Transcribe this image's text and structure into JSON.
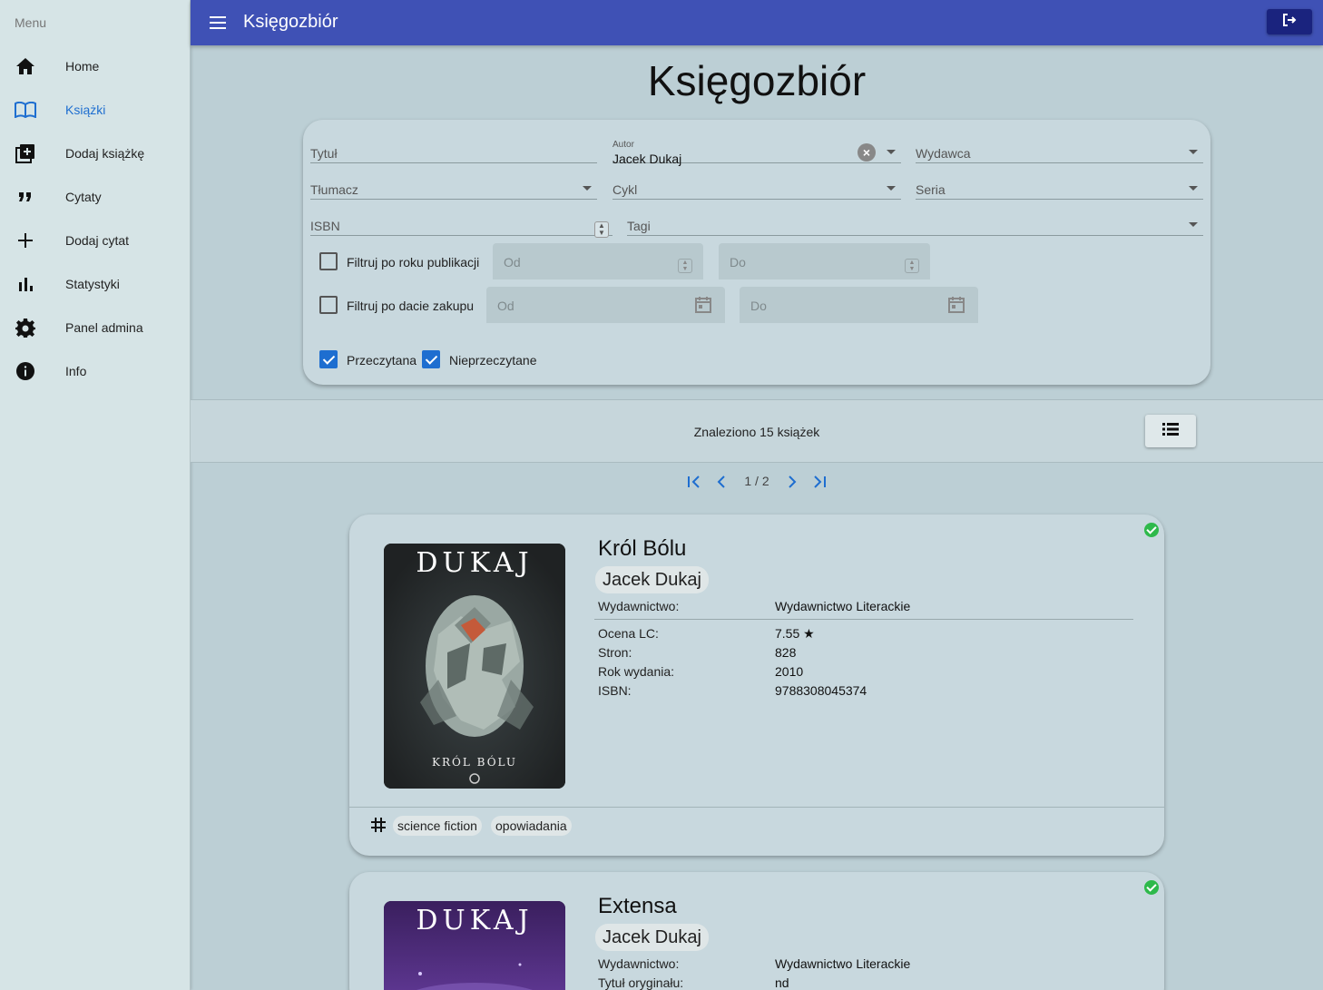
{
  "sidebar": {
    "title": "Menu",
    "items": [
      {
        "label": "Home",
        "icon": "home-icon"
      },
      {
        "label": "Książki",
        "icon": "book-icon"
      },
      {
        "label": "Dodaj książkę",
        "icon": "library-add-icon"
      },
      {
        "label": "Cytaty",
        "icon": "quote-icon"
      },
      {
        "label": "Dodaj cytat",
        "icon": "plus-icon"
      },
      {
        "label": "Statystyki",
        "icon": "bar-chart-icon"
      },
      {
        "label": "Panel admina",
        "icon": "gear-icon"
      },
      {
        "label": "Info",
        "icon": "info-icon"
      }
    ],
    "active_item": "Książki"
  },
  "topbar": {
    "title": "Księgozbiór"
  },
  "page": {
    "title": "Księgozbiór"
  },
  "filters": {
    "tytul_label": "Tytuł",
    "autor_label": "Autor",
    "autor_value": "Jacek Dukaj",
    "wydawca_label": "Wydawca",
    "tlumacz_label": "Tłumacz",
    "cykl_label": "Cykl",
    "seria_label": "Seria",
    "isbn_label": "ISBN",
    "tagi_label": "Tagi",
    "year_filter_label": "Filtruj po roku publikacji",
    "year_from_placeholder": "Od",
    "year_to_placeholder": "Do",
    "purchase_filter_label": "Filtruj po dacie zakupu",
    "purchase_from_placeholder": "Od",
    "purchase_to_placeholder": "Do",
    "read_label": "Przeczytana",
    "unread_label": "Nieprzeczytane",
    "read_checked": true,
    "unread_checked": true,
    "year_checked": false,
    "purchase_checked": false
  },
  "results": {
    "found_text": "Znaleziono 15 książek",
    "page_indicator": "1 / 2"
  },
  "books": [
    {
      "title": "Król Bólu",
      "author": "Jacek Dukaj",
      "cover_author": "DUKAJ",
      "cover_title": "KRÓL BÓLU",
      "read": true,
      "publisher_key": "Wydawnictwo:",
      "publisher": "Wydawnictwo Literackie",
      "details": [
        {
          "key": "Ocena LC:",
          "value": "7.55 ★"
        },
        {
          "key": "Stron:",
          "value": "828"
        },
        {
          "key": "Rok wydania:",
          "value": "2010"
        },
        {
          "key": "ISBN:",
          "value": "9788308045374"
        }
      ],
      "tags": [
        "science fiction",
        "opowiadania"
      ]
    },
    {
      "title": "Extensa",
      "author": "Jacek Dukaj",
      "cover_author": "DUKAJ",
      "read": true,
      "publisher_key": "Wydawnictwo:",
      "publisher": "Wydawnictwo Literackie",
      "details": [
        {
          "key": "Tytuł oryginału:",
          "value": "nd"
        }
      ]
    }
  ],
  "colors": {
    "topbar": "#3f51b5",
    "accent": "#1e6ed0",
    "read_badge": "#2eb94b",
    "background": "#bccfd5",
    "sidebar": "#d6e4e6"
  }
}
